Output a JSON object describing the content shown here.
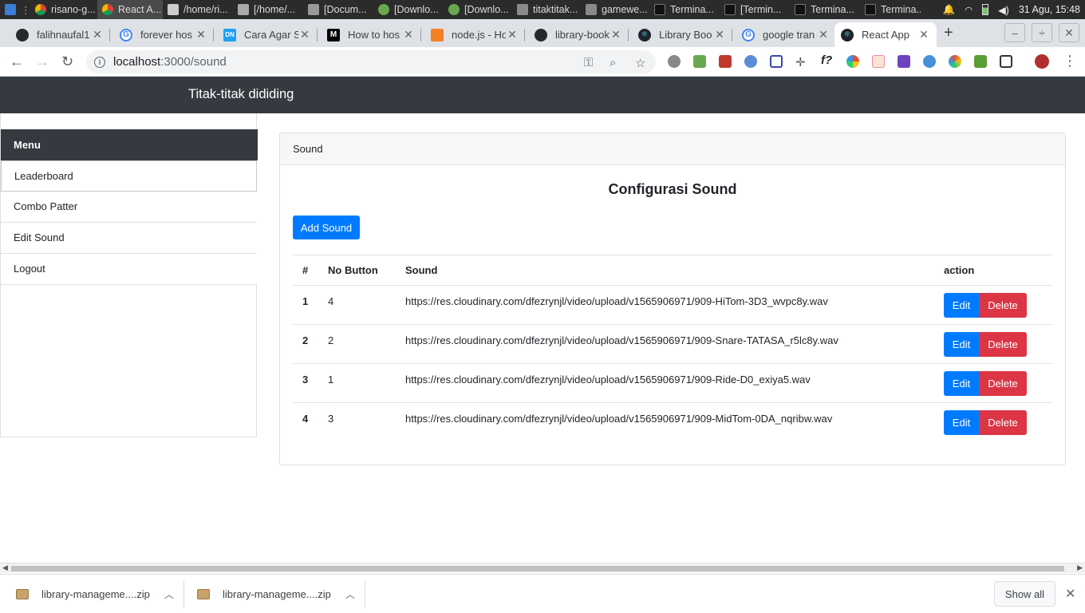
{
  "os": {
    "taskbar": [
      "risano-g...",
      "React A...",
      "/home/ri...",
      "[/home/...",
      "[Docum...",
      "[Downlo...",
      "[Downlo...",
      "titaktitak...",
      "gamewe...",
      "Termina...",
      "[Termin...",
      "Termina...",
      "Termina..."
    ],
    "clock": "31 Agu, 15:48"
  },
  "browser": {
    "tabs": [
      {
        "title": "falihnaufal1",
        "color": "#24292e"
      },
      {
        "title": "forever hos",
        "color": "#4285f4"
      },
      {
        "title": "Cara Agar S",
        "color": "#1da1f2"
      },
      {
        "title": "How to hos",
        "color": "#000000"
      },
      {
        "title": "node.js - Ho",
        "color": "#f48024"
      },
      {
        "title": "library-book",
        "color": "#24292e"
      },
      {
        "title": "Library Boo",
        "color": "#20232a"
      },
      {
        "title": "google tran",
        "color": "#4285f4"
      },
      {
        "title": "React App",
        "color": "#20232a"
      }
    ],
    "url_host": "localhost",
    "url_path": ":3000/sound"
  },
  "app": {
    "brand": "Titak-titak dididing",
    "menu_title": "Menu",
    "menu": [
      "Leaderboard",
      "Combo Patter",
      "Edit Sound",
      "Logout"
    ],
    "card_header": "Sound",
    "page_title": "Configurasi Sound",
    "add_label": "Add Sound",
    "table": {
      "headers": [
        "#",
        "No Button",
        "Sound",
        "action"
      ],
      "rows": [
        {
          "idx": "1",
          "button": "4",
          "sound": "https://res.cloudinary.com/dfezrynjl/video/upload/v1565906971/909-HiTom-3D3_wvpc8y.wav"
        },
        {
          "idx": "2",
          "button": "2",
          "sound": "https://res.cloudinary.com/dfezrynjl/video/upload/v1565906971/909-Snare-TATASA_r5lc8y.wav"
        },
        {
          "idx": "3",
          "button": "1",
          "sound": "https://res.cloudinary.com/dfezrynjl/video/upload/v1565906971/909-Ride-D0_exiya5.wav"
        },
        {
          "idx": "4",
          "button": "3",
          "sound": "https://res.cloudinary.com/dfezrynjl/video/upload/v1565906971/909-MidTom-0DA_nqribw.wav"
        }
      ],
      "edit_label": "Edit",
      "delete_label": "Delete"
    }
  },
  "downloads": {
    "items": [
      "library-manageme....zip",
      "library-manageme....zip"
    ],
    "show_all": "Show all"
  }
}
